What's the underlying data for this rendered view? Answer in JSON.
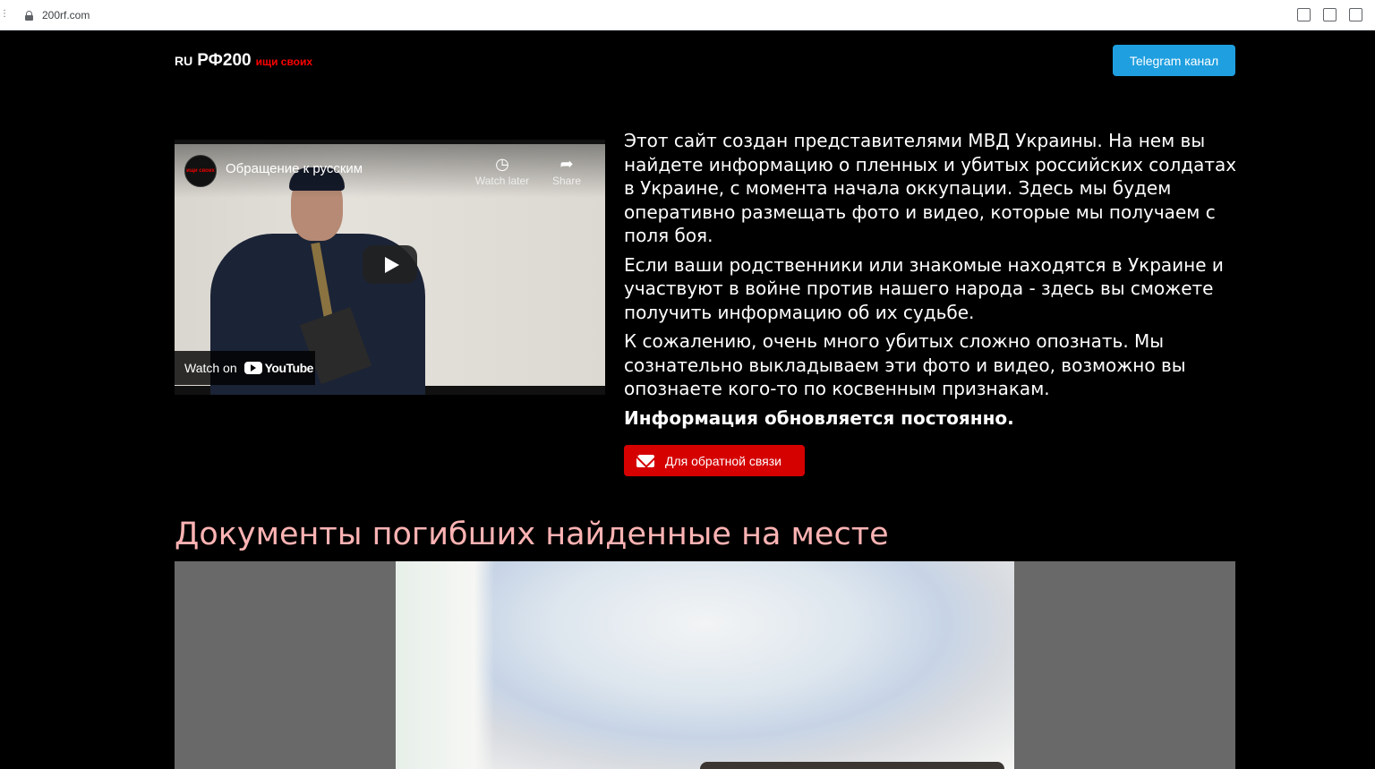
{
  "browser": {
    "url": "200rf.com"
  },
  "header": {
    "logo_ru": "RU",
    "logo_name": "РФ200",
    "logo_tag": "ищи своих",
    "telegram_button": "Telegram канал"
  },
  "video": {
    "channel_avatar_text": "ищи своих",
    "title": "Обращение к русским",
    "watch_later": "Watch later",
    "share": "Share",
    "watch_on": "Watch on",
    "youtube": "YouTube"
  },
  "intro": {
    "p1": "Этот сайт создан представителями МВД Украины. На нем вы найдете информацию о пленных и убитых российских солдатах в Украине, с момента начала оккупации. Здесь мы будем оперативно размещать фото и видео, которые мы получаем с поля боя.",
    "p2": "Если ваши родственники или знакомые находятся в Украине и участвуют в войне против нашего народа - здесь вы сможете получить информацию об их судьбе.",
    "p3": "К сожалению, очень много убитых сложно опознать. Мы сознательно выкладываем эти фото и видео, возможно вы опознаете кого-то по косвенным признакам.",
    "p4": "Информация обновляется постоянно.",
    "feedback_button": "Для обратной связи"
  },
  "documents": {
    "title": "Документы погибших найденные на месте"
  },
  "colors": {
    "accent_blue": "#1f9fe0",
    "accent_red": "#d50000",
    "title_pink": "#ffb3b3",
    "logo_red": "#ff0000"
  }
}
